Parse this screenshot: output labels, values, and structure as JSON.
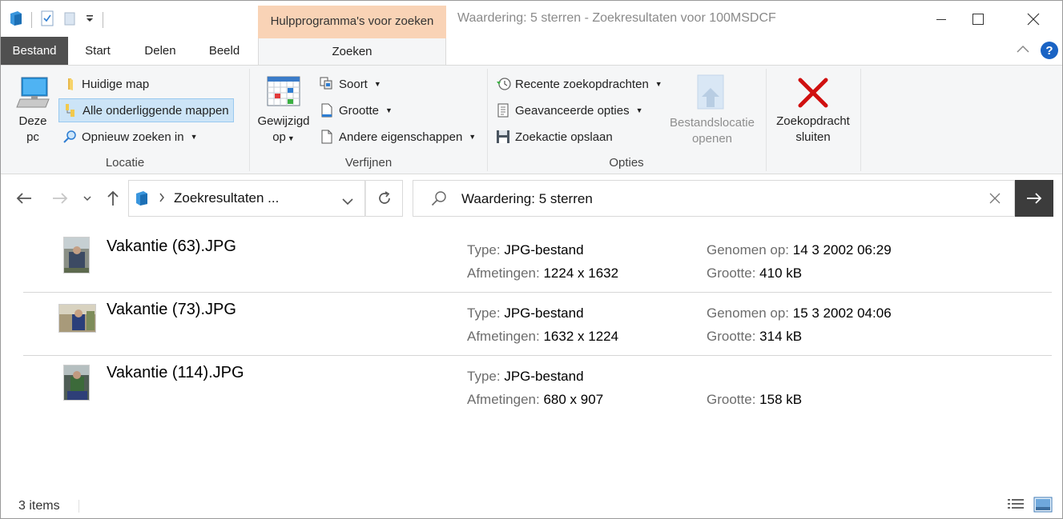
{
  "window": {
    "context_tab": "Hulpprogramma's voor zoeken",
    "title": "Waardering: 5 sterren - Zoekresultaten voor 100MSDCF"
  },
  "tabs": {
    "file": "Bestand",
    "start": "Start",
    "share": "Delen",
    "view": "Beeld",
    "search": "Zoeken"
  },
  "ribbon": {
    "locatie": {
      "label": "Locatie",
      "this_pc_line1": "Deze",
      "this_pc_line2": "pc",
      "current_folder": "Huidige map",
      "all_subfolders": "Alle onderliggende mappen",
      "search_again": "Opnieuw zoeken in"
    },
    "verfijnen": {
      "label": "Verfijnen",
      "modified_line1": "Gewijzigd",
      "modified_line2": "op",
      "kind": "Soort",
      "size": "Grootte",
      "other_props": "Andere eigenschappen"
    },
    "opties": {
      "label": "Opties",
      "recent": "Recente zoekopdrachten",
      "advanced": "Geavanceerde opties",
      "save": "Zoekactie opslaan",
      "open_location_line1": "Bestandslocatie",
      "open_location_line2": "openen",
      "close_line1": "Zoekopdracht",
      "close_line2": "sluiten"
    }
  },
  "address": {
    "breadcrumb": "Zoekresultaten ...",
    "search_value": "Waardering: 5 sterren"
  },
  "results": [
    {
      "name": "Vakantie (63).JPG",
      "type_label": "Type:",
      "type": "JPG-bestand",
      "dim_label": "Afmetingen:",
      "dimensions": "1224 x 1632",
      "taken_label": "Genomen op:",
      "taken": "14 3 2002 06:29",
      "size_label": "Grootte:",
      "size": "410 kB"
    },
    {
      "name": "Vakantie (73).JPG",
      "type_label": "Type:",
      "type": "JPG-bestand",
      "dim_label": "Afmetingen:",
      "dimensions": "1632 x 1224",
      "taken_label": "Genomen op:",
      "taken": "15 3 2002 04:06",
      "size_label": "Grootte:",
      "size": "314 kB"
    },
    {
      "name": "Vakantie (114).JPG",
      "type_label": "Type:",
      "type": "JPG-bestand",
      "dim_label": "Afmetingen:",
      "dimensions": "680 x 907",
      "size_label": "Grootte:",
      "size": "158 kB"
    }
  ],
  "status": {
    "count": "3 items"
  },
  "colors": {
    "context_tab": "#f9d3b6",
    "file_tab": "#505050",
    "selected": "#cce4f7",
    "go_button": "#3c3c3c",
    "close_x": "#d01010",
    "help": "#1a63c4"
  }
}
